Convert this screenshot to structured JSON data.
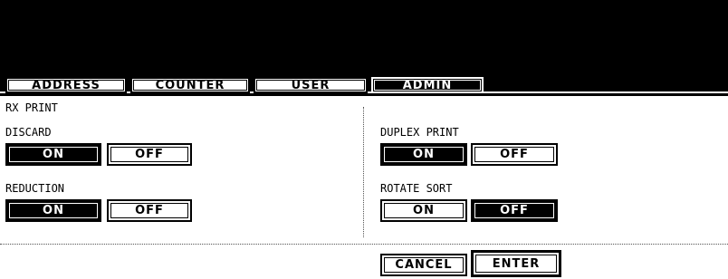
{
  "tabs": [
    {
      "label": "ADDRESS",
      "active": false
    },
    {
      "label": "COUNTER",
      "active": false
    },
    {
      "label": "USER",
      "active": false
    },
    {
      "label": "ADMIN",
      "active": true
    }
  ],
  "section_title": "RX PRINT",
  "discard": {
    "label": "DISCARD",
    "on_label": "ON",
    "off_label": "OFF",
    "selected": "ON"
  },
  "reduction": {
    "label": "REDUCTION",
    "on_label": "ON",
    "off_label": "OFF",
    "selected": "ON"
  },
  "duplex_print": {
    "label": "DUPLEX PRINT",
    "on_label": "ON",
    "off_label": "OFF",
    "selected": "ON"
  },
  "rotate_sort": {
    "label": "ROTATE SORT",
    "on_label": "ON",
    "off_label": "OFF",
    "selected": "OFF"
  },
  "footer": {
    "cancel_label": "CANCEL",
    "enter_label": "ENTER"
  },
  "colors": {
    "background": "#ffffff",
    "header": "#000000",
    "selected": "#000000"
  }
}
